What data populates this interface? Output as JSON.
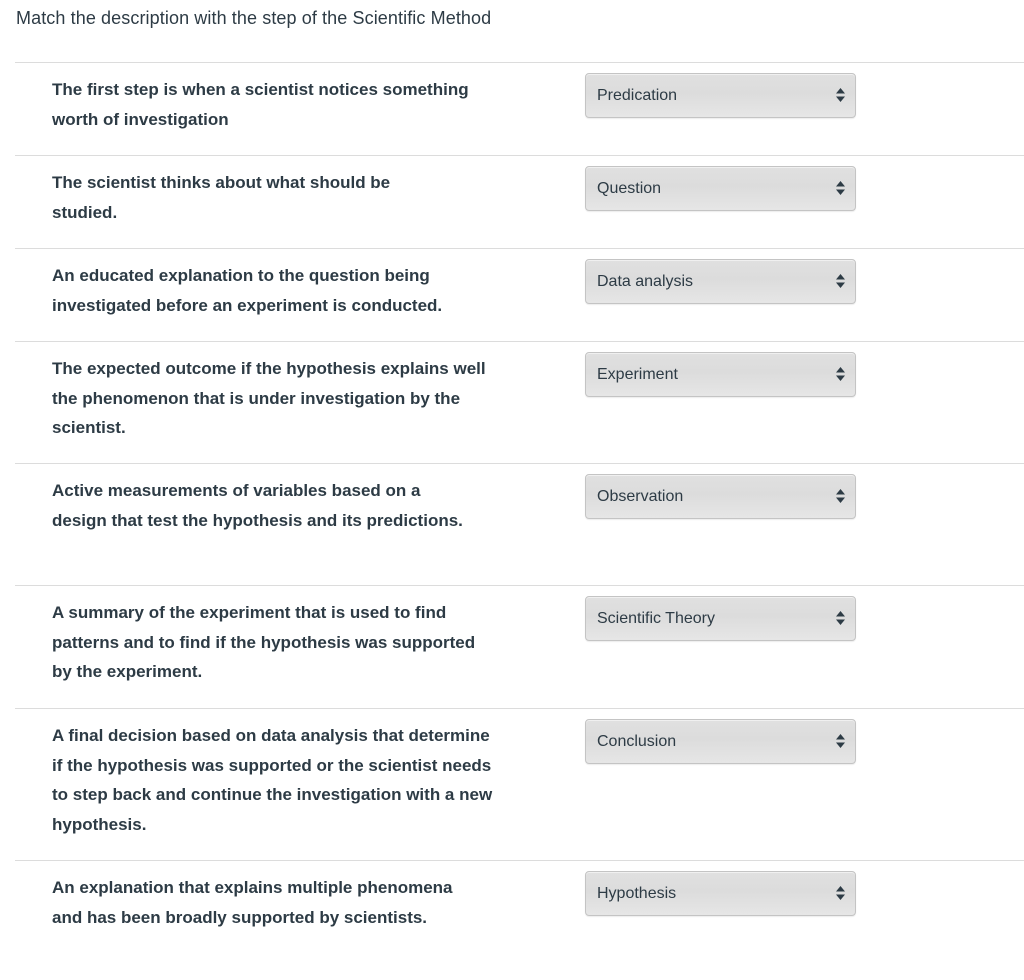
{
  "question": {
    "title": "Match the description with the step of the Scientific Method"
  },
  "matches": [
    {
      "description": "The first step is when a scientist notices something worth of investigation",
      "selected": "Predication"
    },
    {
      "description": "The scientist thinks about what should be studied.",
      "selected": "Question"
    },
    {
      "description": "An educated explanation to the question being investigated before an experiment is conducted.",
      "selected": "Data analysis"
    },
    {
      "description": "The expected outcome if the hypothesis explains well the phenomenon that is under investigation by the scientist.",
      "selected": "Experiment"
    },
    {
      "description": "Active measurements of variables based on a design that test the hypothesis and its predictions.",
      "selected": "Observation"
    },
    {
      "description": "A summary of the experiment that is used to find patterns and to find if the hypothesis was supported by the experiment.",
      "selected": "Scientific Theory"
    },
    {
      "description": "A final decision based on data analysis that determine if the hypothesis was supported or the scientist needs to step back and continue the investigation with a new hypothesis.",
      "selected": "Conclusion"
    },
    {
      "description": "An explanation that explains multiple phenomena and has been broadly supported by scientists.",
      "selected": "Hypothesis"
    }
  ],
  "icons": {
    "select_arrow": "up-down-arrows-icon"
  },
  "colors": {
    "text": "#2d3b45",
    "divider": "#dcdcdc",
    "select_bg": "#dedede",
    "select_border": "#c4c4c4"
  }
}
